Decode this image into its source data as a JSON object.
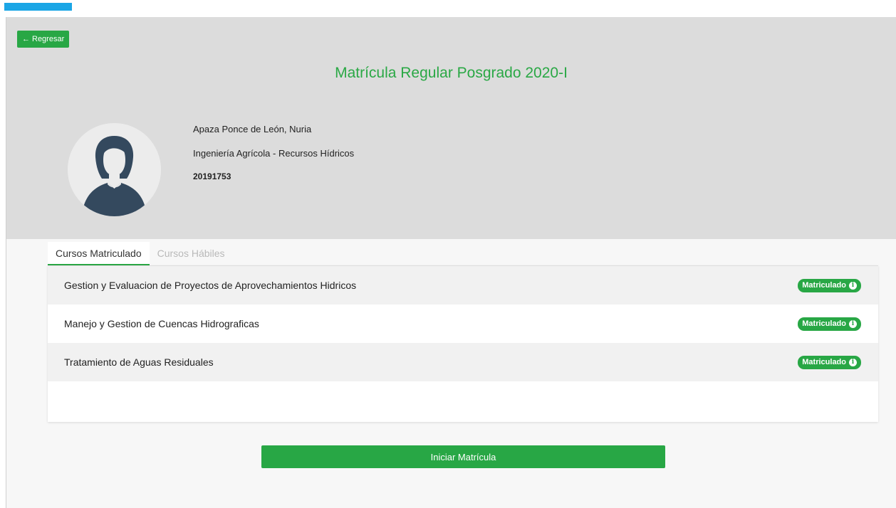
{
  "header": {
    "back_label": "Regresar",
    "title": "Matrícula Regular Posgrado 2020-I"
  },
  "student": {
    "name": "Apaza Ponce de León, Nuria",
    "program": "Ingeniería Agrícola - Recursos Hídricos",
    "code": "20191753",
    "avatar_icon": "user-avatar-icon"
  },
  "tabs": [
    {
      "label": "Cursos Matriculado",
      "active": true
    },
    {
      "label": "Cursos Hábiles",
      "active": false
    }
  ],
  "courses": [
    {
      "name": "Gestion y Evaluacion de Proyectos de Aprovechamientos Hidricos",
      "status": "Matriculado"
    },
    {
      "name": "Manejo y Gestion de Cuencas Hidrograficas",
      "status": "Matriculado"
    },
    {
      "name": "Tratamiento de Aguas Residuales",
      "status": "Matriculado"
    }
  ],
  "actions": {
    "start_label": "Iniciar Matrícula"
  },
  "colors": {
    "accent_green": "#28a745",
    "title_green": "#2aa845",
    "top_bar_blue": "#1ba6e6",
    "header_bg": "#dcdcdc"
  }
}
